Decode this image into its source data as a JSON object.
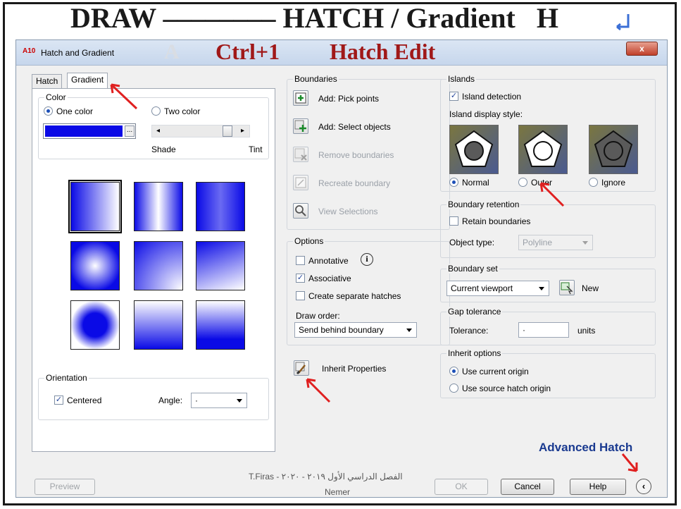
{
  "slide": {
    "title": "DRAW –––––––– HATCH / Gradient   H",
    "ctrl_label": "Ctrl+1",
    "edit_label": "Hatch Edit",
    "advanced_label": "Advanced Hatch",
    "footer_arabic": "الفصل الدراسي الأول ٢٠١٩ - ٢٠٢٠  -  T.Firas",
    "footer_name": "Nemer"
  },
  "dialog": {
    "title": "Hatch and Gradient",
    "app_icon_text": "A10",
    "close_label": "x"
  },
  "tabs": [
    "Hatch",
    "Gradient"
  ],
  "color": {
    "group_label": "Color",
    "one_color": "One color",
    "two_color": "Two color",
    "shade": "Shade",
    "tint": "Tint",
    "swatch_color": "#0a0ae6"
  },
  "orientation": {
    "group_label": "Orientation",
    "centered": "Centered",
    "angle_label": "Angle:",
    "angle_value": "·"
  },
  "boundaries": {
    "group_label": "Boundaries",
    "add_pick": "Add: Pick points",
    "add_select": "Add: Select objects",
    "remove": "Remove boundaries",
    "recreate": "Recreate boundary",
    "view": "View Selections"
  },
  "options": {
    "group_label": "Options",
    "annotative": "Annotative",
    "associative": "Associative",
    "separate": "Create separate hatches",
    "draw_order_label": "Draw order:",
    "draw_order_value": "Send behind boundary"
  },
  "inherit_properties": "Inherit Properties",
  "islands": {
    "group_label": "Islands",
    "detection": "Island detection",
    "display_style": "Island display style:",
    "normal": "Normal",
    "outer": "Outer",
    "ignore": "Ignore"
  },
  "retention": {
    "group_label": "Boundary retention",
    "retain": "Retain boundaries",
    "object_type_label": "Object type:",
    "object_type_value": "Polyline"
  },
  "boundary_set": {
    "group_label": "Boundary set",
    "value": "Current viewport",
    "new_label": "New"
  },
  "gap": {
    "group_label": "Gap tolerance",
    "tolerance_label": "Tolerance:",
    "tolerance_value": "·",
    "units": "units"
  },
  "inherit_options": {
    "group_label": "Inherit options",
    "current_origin": "Use current origin",
    "source_origin": "Use source hatch origin"
  },
  "buttons": {
    "preview": "Preview",
    "ok": "OK",
    "cancel": "Cancel",
    "help": "Help"
  },
  "colors": {
    "gradient_blue": "#0a0ae6",
    "annotation_red": "#a01818",
    "arrow_red": "#e02020"
  }
}
